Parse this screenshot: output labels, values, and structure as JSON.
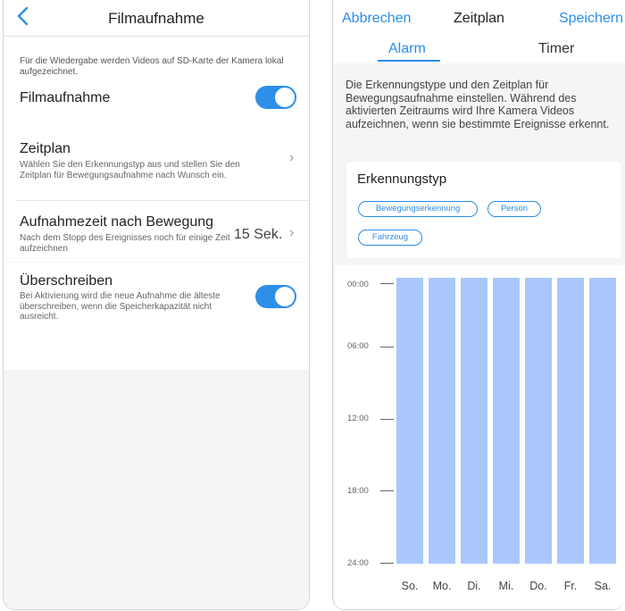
{
  "left": {
    "header": {
      "title": "Filmaufnahme",
      "back_icon": "chevron-left-icon"
    },
    "info_text": "Für die Wiedergabe werden Videos auf SD-Karte der Kamera lokal aufgezeichnet.",
    "recording": {
      "label": "Filmaufnahme",
      "enabled": true
    },
    "schedule": {
      "title": "Zeitplan",
      "subtitle": "Wählen Sie den Erkennungstyp aus und stellen Sie den Zeitplan für Bewegungsaufnahme nach Wunsch ein."
    },
    "post_motion": {
      "title": "Aufnahmezeit nach Bewegung",
      "subtitle": "Nach dem Stopp des Ereignisses noch für einige Zeit aufzeichnen",
      "value": "15 Sek."
    },
    "overwrite": {
      "title": "Überschreiben",
      "subtitle": "Bei Aktivierung wird die neue Aufnahme die älteste überschreiben, wenn die Speicherkapazität nicht ausreicht.",
      "enabled": true
    }
  },
  "right": {
    "header": {
      "cancel": "Abbrechen",
      "title": "Zeitplan",
      "save": "Speichern"
    },
    "tabs": [
      {
        "label": "Alarm",
        "active": true
      },
      {
        "label": "Timer",
        "active": false
      }
    ],
    "description": "Die Erkennungstype und den Zeitplan für Bewegungsaufnahme einstellen. Während des aktivierten Zeitraums wird Ihre Kamera Videos aufzeichnen, wenn sie bestimmte Ereignisse erkennt.",
    "detection": {
      "title": "Erkennungstyp",
      "types": [
        "Bewegungserkennung",
        "Person",
        "Fahrzeug"
      ]
    },
    "schedule": {
      "times": [
        "00:00",
        "06:00",
        "12:00",
        "18:00",
        "24:00"
      ],
      "days": [
        "So.",
        "Mo.",
        "Di.",
        "Mi.",
        "Do.",
        "Fr.",
        "Sa."
      ],
      "active_fraction": 1.0,
      "active_color": "#a9c7fb"
    }
  },
  "colors": {
    "accent": "#2c8de6",
    "toggle_on": "#2e8fe8"
  }
}
